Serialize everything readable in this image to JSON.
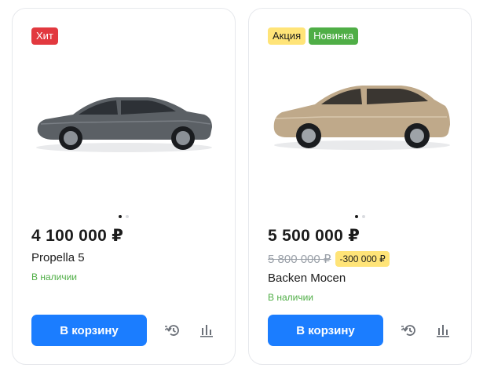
{
  "products": [
    {
      "badges": [
        {
          "label": "Хит",
          "color": "#e2393f"
        }
      ],
      "price": "4 100 000 ₽",
      "old_price": "",
      "discount": "",
      "name": "Propella 5",
      "stock": "В наличии",
      "car_color": "#5b6065",
      "button_label": "В корзину",
      "slider": {
        "total": 2,
        "active": 1
      }
    },
    {
      "badges": [
        {
          "label": "Акция",
          "color": "#ffe478"
        },
        {
          "label": "Новинка",
          "color": "#4fae46"
        }
      ],
      "price": "5 500 000 ₽",
      "old_price": "5 800 000 ₽",
      "discount": "-300 000 ₽",
      "name": "Backen Mocen",
      "stock": "В наличии",
      "car_color": "#bfa98a",
      "button_label": "В корзину",
      "slider": {
        "total": 2,
        "active": 1
      }
    }
  ],
  "colors": {
    "accent": "#1b7dff",
    "in_stock": "#4fae46"
  },
  "icons": {
    "compare": "history-compare-icon",
    "stats": "bar-chart-icon"
  }
}
